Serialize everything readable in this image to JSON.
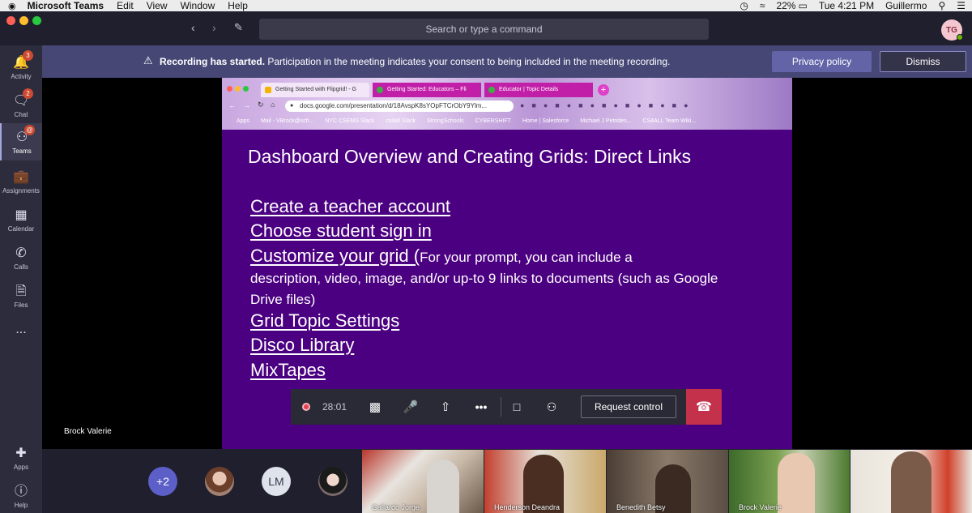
{
  "menubar": {
    "app_name": "Microsoft Teams",
    "items": [
      "Edit",
      "View",
      "Window",
      "Help"
    ],
    "battery": "22%",
    "clock": "Tue 4:21 PM",
    "user": "Guillermo"
  },
  "titlebar": {
    "search_placeholder": "Search or type a command",
    "avatar_initials": "TG"
  },
  "rail": {
    "items": [
      {
        "label": "Activity",
        "badge": "3"
      },
      {
        "label": "Chat",
        "badge": "2"
      },
      {
        "label": "Teams",
        "badge": "@"
      },
      {
        "label": "Assignments"
      },
      {
        "label": "Calendar"
      },
      {
        "label": "Calls"
      },
      {
        "label": "Files"
      },
      {
        "label": "..."
      },
      {
        "label": "Apps"
      },
      {
        "label": "Help"
      }
    ]
  },
  "banner": {
    "bold": "Recording has started.",
    "text": "Participation in the meeting indicates your consent to being included in the meeting recording.",
    "privacy_label": "Privacy policy",
    "dismiss_label": "Dismiss"
  },
  "browser": {
    "tabs": [
      "Getting Started with Flipgrid! - G",
      "Getting Started: Educators – Fli",
      "Educator | Topic Details"
    ],
    "url": "docs.google.com/presentation/d/18AvspK8sYOpFTCrObY9Ylm...",
    "bookmarks": [
      "Apps",
      "Mail - VBrock@sch...",
      "NYC CSEMS Slack",
      "cs4all Slack",
      "StrongSchools",
      "CYBERSHIFT",
      "Home | Salesforce",
      "Michael J Petrides...",
      "CS4ALL Team Wiki..."
    ]
  },
  "slide": {
    "title": "Dashboard Overview and Creating Grids: Direct Links",
    "link_create": "Create a teacher account",
    "link_signin": "Choose student sign in",
    "link_customize": "Customize your grid (",
    "customize_desc_first": "For your prompt, you can include a",
    "customize_desc_rest": "description, video, image, and/or up-to 9 links to documents (such as Google Drive files)",
    "link_settings": "Grid Topic Settings",
    "link_disco": "Disco Library",
    "link_mixtapes": "MixTapes"
  },
  "controls": {
    "timer": "28:01",
    "request_label": "Request control"
  },
  "presenter_name": "Brock Valerie",
  "gallery": {
    "overflow": "+2",
    "initials": "LM",
    "tiles": [
      "Gallardo Jorge",
      "Henderson Deandra",
      "Benedith Betsy",
      "Brock Valerie",
      ""
    ]
  },
  "colors": {
    "accent": "#464775",
    "slide_bg": "#4b0082",
    "hangup": "#c4314b",
    "rail": "#2d2c3d"
  }
}
